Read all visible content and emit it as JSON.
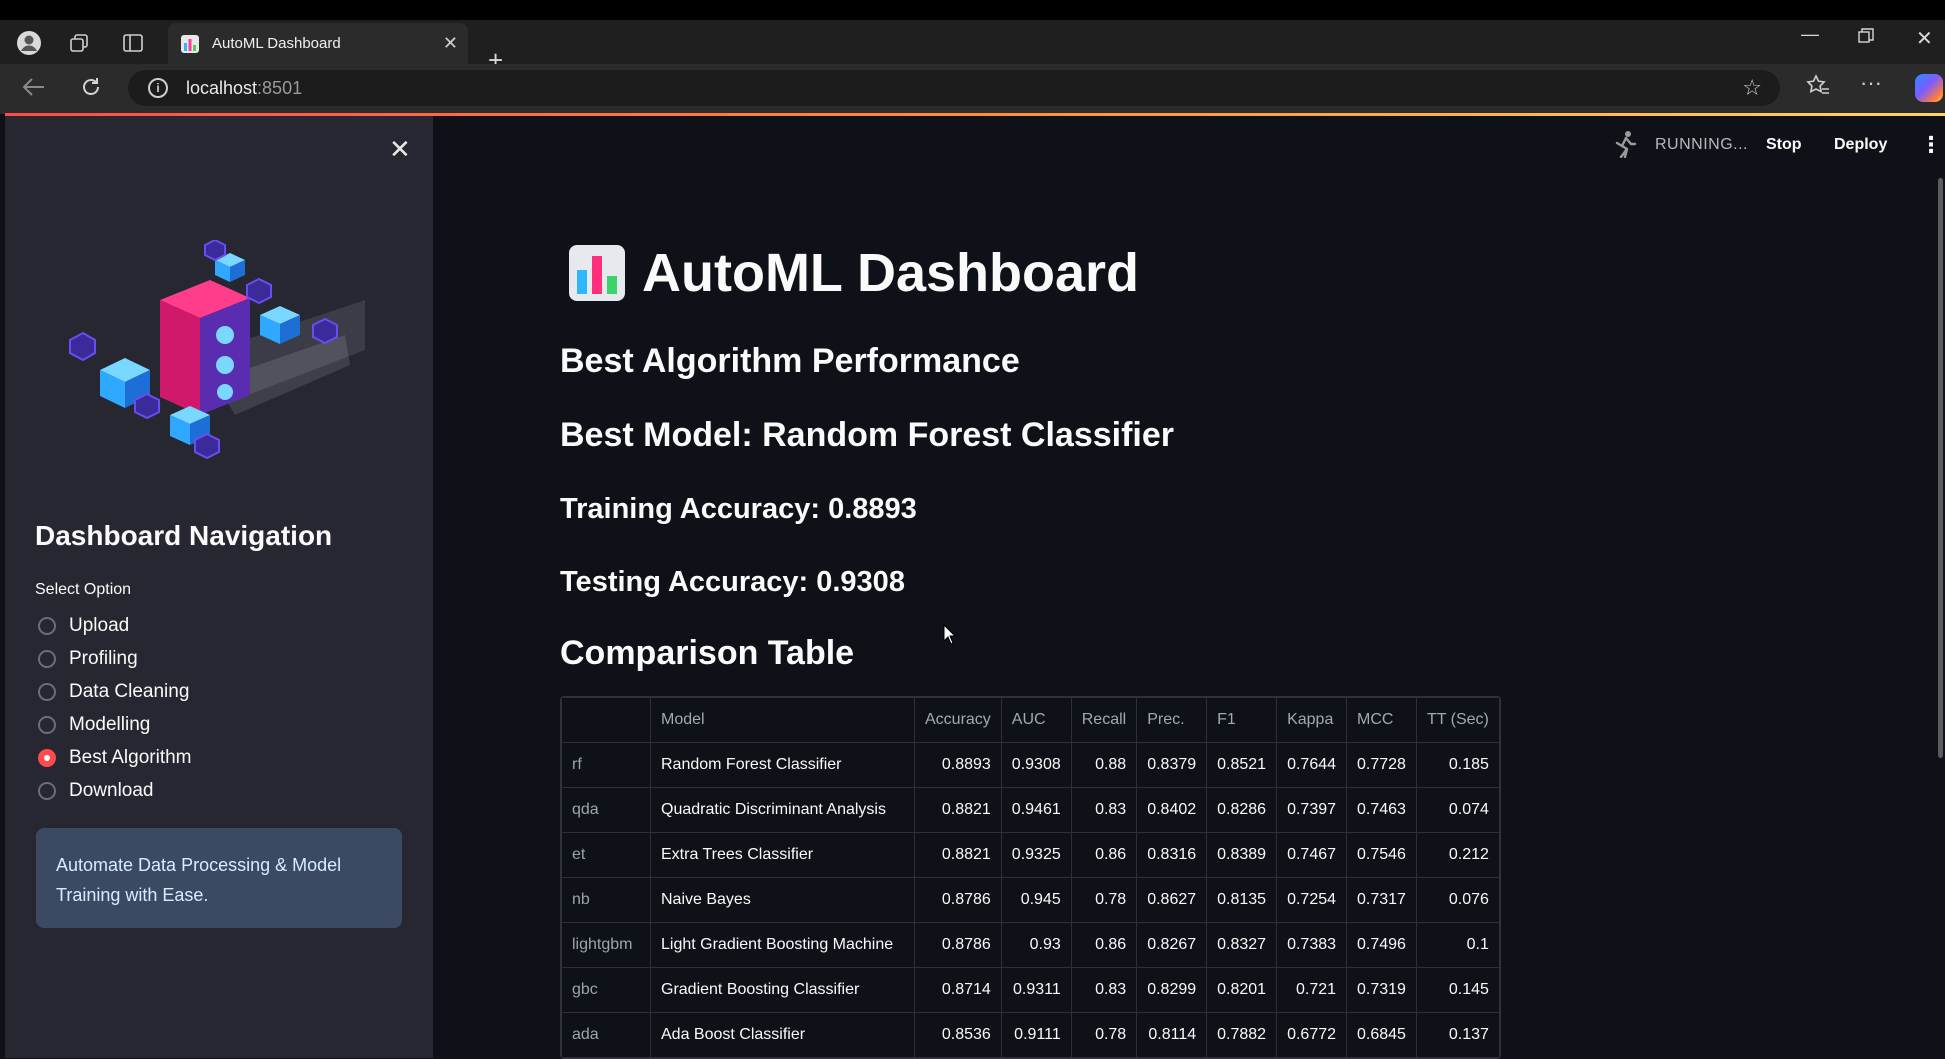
{
  "browser": {
    "tab_title": "AutoML Dashboard",
    "url_host": "localhost",
    "url_port": ":8501"
  },
  "sidebar": {
    "title": "Dashboard Navigation",
    "select_label": "Select Option",
    "options": [
      "Upload",
      "Profiling",
      "Data Cleaning",
      "Modelling",
      "Best Algorithm",
      "Download"
    ],
    "selected_option": "Best Algorithm",
    "info_text": "Automate Data Processing & Model Training with Ease.",
    "illustration_icon": "isometric-data-cubes-illustration"
  },
  "header": {
    "status": "RUNNING...",
    "stop_label": "Stop",
    "deploy_label": "Deploy"
  },
  "main": {
    "title": "AutoML Dashboard",
    "title_icon": "bar-chart-emoji",
    "section_best": "Best Algorithm Performance",
    "best_model": "Best Model: Random Forest Classifier",
    "training_accuracy": "Training Accuracy: 0.8893",
    "testing_accuracy": "Testing Accuracy: 0.9308",
    "comparison_title": "Comparison Table"
  },
  "table": {
    "columns": [
      "",
      "Model",
      "Accuracy",
      "AUC",
      "Recall",
      "Prec.",
      "F1",
      "Kappa",
      "MCC",
      "TT (Sec)"
    ],
    "rows": [
      [
        "rf",
        "Random Forest Classifier",
        "0.8893",
        "0.9308",
        "0.88",
        "0.8379",
        "0.8521",
        "0.7644",
        "0.7728",
        "0.185"
      ],
      [
        "qda",
        "Quadratic Discriminant Analysis",
        "0.8821",
        "0.9461",
        "0.83",
        "0.8402",
        "0.8286",
        "0.7397",
        "0.7463",
        "0.074"
      ],
      [
        "et",
        "Extra Trees Classifier",
        "0.8821",
        "0.9325",
        "0.86",
        "0.8316",
        "0.8389",
        "0.7467",
        "0.7546",
        "0.212"
      ],
      [
        "nb",
        "Naive Bayes",
        "0.8786",
        "0.945",
        "0.78",
        "0.8627",
        "0.8135",
        "0.7254",
        "0.7317",
        "0.076"
      ],
      [
        "lightgbm",
        "Light Gradient Boosting Machine",
        "0.8786",
        "0.93",
        "0.86",
        "0.8267",
        "0.8327",
        "0.7383",
        "0.7496",
        "0.1"
      ],
      [
        "gbc",
        "Gradient Boosting Classifier",
        "0.8714",
        "0.9311",
        "0.83",
        "0.8299",
        "0.8201",
        "0.721",
        "0.7319",
        "0.145"
      ],
      [
        "ada",
        "Ada Boost Classifier",
        "0.8536",
        "0.9111",
        "0.78",
        "0.8114",
        "0.7882",
        "0.6772",
        "0.6845",
        "0.137"
      ]
    ]
  },
  "colors": {
    "accent": "#ff4b4b",
    "app_background": "#0e1117",
    "sidebar_background": "#262730",
    "info_box_background": "#3b4a62"
  }
}
